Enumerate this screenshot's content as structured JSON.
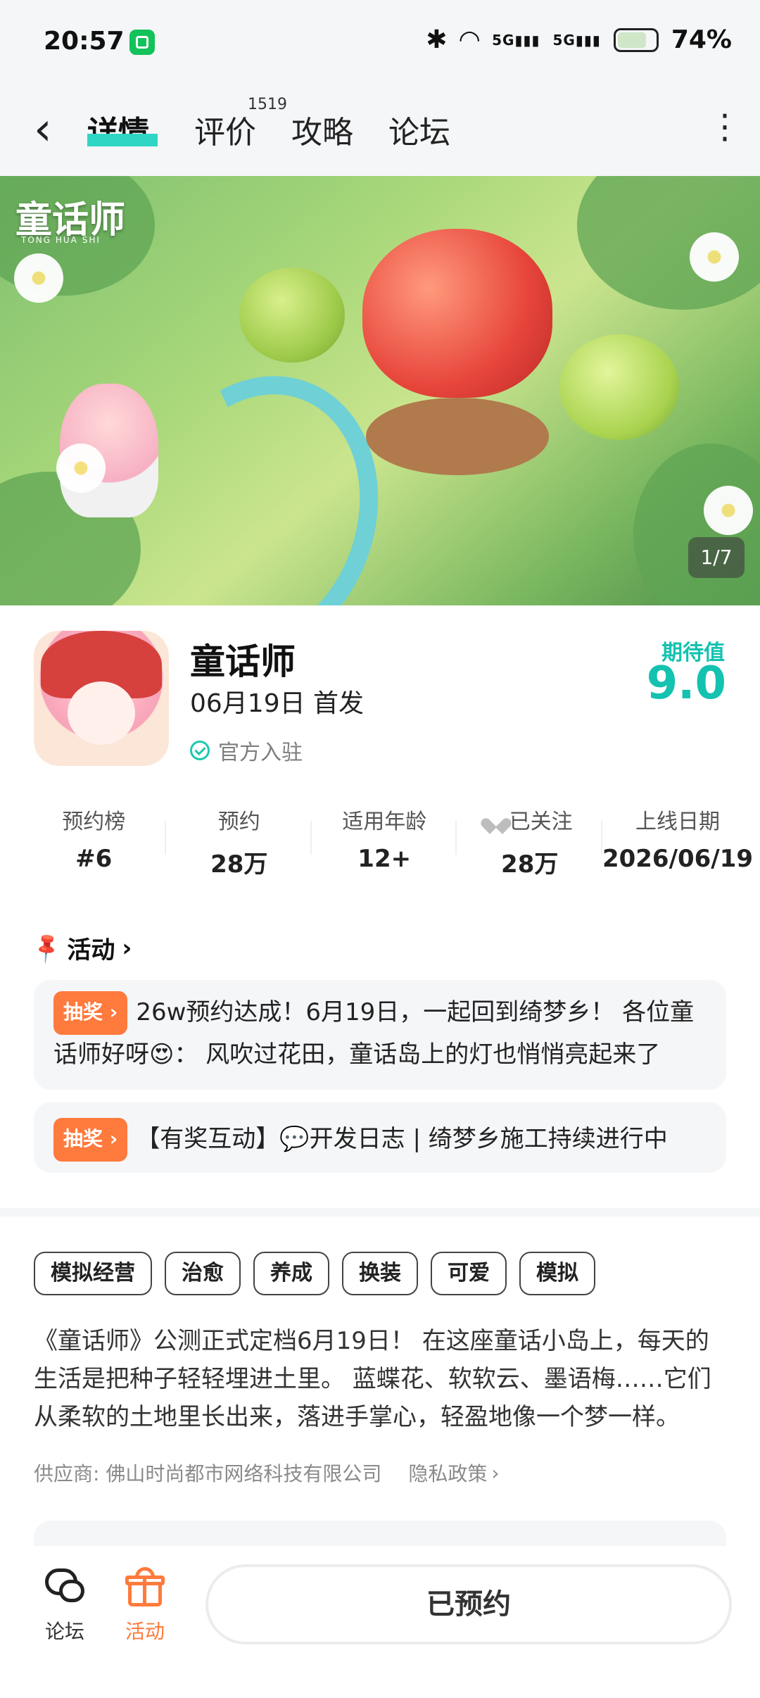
{
  "status_bar": {
    "time": "20:57",
    "signal1": "5G",
    "signal2": "5G",
    "battery": "74%",
    "icons": [
      "notification-app-icon",
      "bluetooth-icon",
      "wifi-icon",
      "signal-icon",
      "battery-icon"
    ]
  },
  "nav": {
    "tabs": [
      {
        "label": "详情",
        "active": true
      },
      {
        "label": "评价",
        "count": "1519"
      },
      {
        "label": "攻略"
      },
      {
        "label": "论坛"
      }
    ],
    "accent": "#2fd6c4"
  },
  "banner": {
    "title": "童话师",
    "subtitle": "TONG HUA SHI",
    "page_indicator": "1/7"
  },
  "game": {
    "title": "童话师",
    "release": "06月19日 首发",
    "official": "官方入驻",
    "expect_label": "期待值",
    "expect_score": "9.0",
    "accent": "#14c2b0"
  },
  "stats": [
    {
      "label": "预约榜",
      "value": "#6"
    },
    {
      "label": "预约",
      "value": "28万"
    },
    {
      "label": "适用年龄",
      "value": "12+"
    },
    {
      "label": "已关注",
      "value": "28万"
    },
    {
      "label": "上线日期",
      "value": "2026/06/19"
    }
  ],
  "activity": {
    "header": "活动",
    "cards": [
      {
        "badge": "抽奖",
        "text": "26w预约达成！6月19日，一起回到绮梦乡！ 各位童话师好呀😍： 风吹过花田，童话岛上的灯也悄悄亮起来了"
      },
      {
        "badge": "抽奖",
        "text": "【有奖互动】💬开发日志 | 绮梦乡施工持续进行中"
      }
    ],
    "badge_color": "#ff7a3d"
  },
  "tags": [
    "模拟经营",
    "治愈",
    "养成",
    "换装",
    "可爱",
    "模拟"
  ],
  "description": "《童话师》公测正式定档6月19日！ 在这座童话小岛上，每天的生活是把种子轻轻埋进土里。 蓝蝶花、软软云、墨语梅……它们从柔软的土地里长出来，落进手掌心，轻盈地像一个梦一样。",
  "supplier": {
    "label": "供应商: 佛山时尚都市网络科技有限公司",
    "privacy": "隐私政策"
  },
  "bottom_bar": {
    "forum": "论坛",
    "activity": "活动",
    "reserved": "已预约"
  }
}
